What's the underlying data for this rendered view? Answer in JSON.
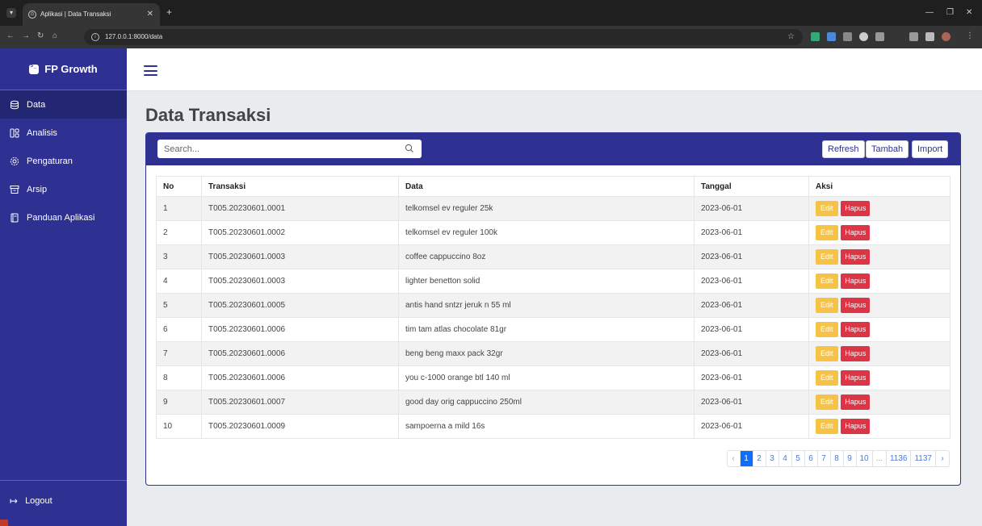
{
  "browser": {
    "tab_title": "Aplikasi | Data Transaksi",
    "url": "127.0.0.1:8000/data"
  },
  "sidebar": {
    "brand": "FP Growth",
    "items": [
      {
        "label": "Data",
        "icon": "database-icon"
      },
      {
        "label": "Analisis",
        "icon": "grid-icon"
      },
      {
        "label": "Pengaturan",
        "icon": "gear-icon"
      },
      {
        "label": "Arsip",
        "icon": "archive-icon"
      },
      {
        "label": "Panduan Aplikasi",
        "icon": "book-icon"
      }
    ],
    "logout": "Logout"
  },
  "main": {
    "title": "Data Transaksi",
    "search_placeholder": "Search...",
    "buttons": {
      "refresh": "Refresh",
      "tambah": "Tambah",
      "import": "Import"
    },
    "columns": [
      "No",
      "Transaksi",
      "Data",
      "Tanggal",
      "Aksi"
    ],
    "rows": [
      {
        "no": "1",
        "transaksi": "T005.20230601.0001",
        "data": "telkomsel ev reguler 25k",
        "tanggal": "2023-06-01"
      },
      {
        "no": "2",
        "transaksi": "T005.20230601.0002",
        "data": "telkomsel ev reguler 100k",
        "tanggal": "2023-06-01"
      },
      {
        "no": "3",
        "transaksi": "T005.20230601.0003",
        "data": "coffee cappuccino 8oz",
        "tanggal": "2023-06-01"
      },
      {
        "no": "4",
        "transaksi": "T005.20230601.0003",
        "data": "lighter benetton solid",
        "tanggal": "2023-06-01"
      },
      {
        "no": "5",
        "transaksi": "T005.20230601.0005",
        "data": "antis hand sntzr jeruk n 55 ml",
        "tanggal": "2023-06-01"
      },
      {
        "no": "6",
        "transaksi": "T005.20230601.0006",
        "data": "tim tam atlas chocolate 81gr",
        "tanggal": "2023-06-01"
      },
      {
        "no": "7",
        "transaksi": "T005.20230601.0006",
        "data": "beng beng maxx pack 32gr",
        "tanggal": "2023-06-01"
      },
      {
        "no": "8",
        "transaksi": "T005.20230601.0006",
        "data": "you c-1000 orange btl 140 ml",
        "tanggal": "2023-06-01"
      },
      {
        "no": "9",
        "transaksi": "T005.20230601.0007",
        "data": "good day orig cappuccino 250ml",
        "tanggal": "2023-06-01"
      },
      {
        "no": "10",
        "transaksi": "T005.20230601.0009",
        "data": "sampoerna a mild 16s",
        "tanggal": "2023-06-01"
      }
    ],
    "actions": {
      "edit": "Edit",
      "hapus": "Hapus"
    },
    "pagination": {
      "prev": "‹",
      "pages": [
        "1",
        "2",
        "3",
        "4",
        "5",
        "6",
        "7",
        "8",
        "9",
        "10",
        "...",
        "1136",
        "1137"
      ],
      "active": "1",
      "next": "›"
    }
  },
  "colors": {
    "brand": "#2e3192",
    "edit": "#f6c344",
    "hapus": "#dc3545",
    "page_active": "#0d6efd"
  }
}
